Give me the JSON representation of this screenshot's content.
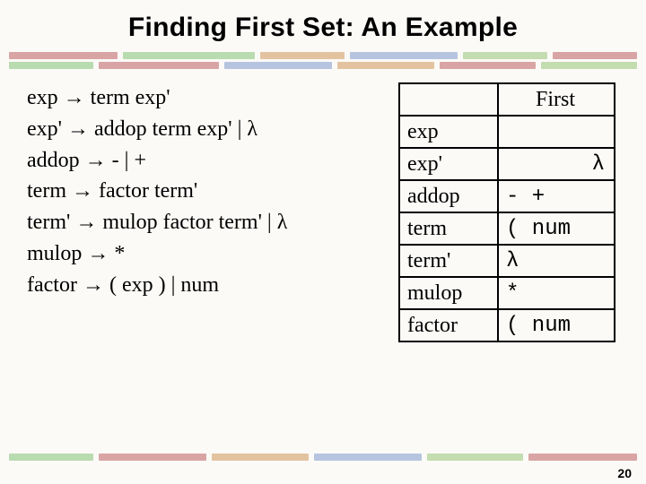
{
  "title": "Finding First Set: An Example",
  "grammar": {
    "lines": [
      {
        "lhs": "exp",
        "rhs": "term exp'"
      },
      {
        "lhs": "exp'",
        "rhs": "addop term exp' | λ"
      },
      {
        "lhs": "addop",
        "rhs": "- | +"
      },
      {
        "lhs": "term",
        "rhs": "factor term'"
      },
      {
        "lhs": "term'",
        "rhs": "mulop factor term' | λ"
      },
      {
        "lhs": "mulop",
        "rhs": "*"
      },
      {
        "lhs": "factor",
        "rhs": "( exp ) | num"
      }
    ],
    "arrow": "→"
  },
  "table": {
    "header": "First",
    "rows": [
      {
        "nt": "exp",
        "first": ""
      },
      {
        "nt": "exp'",
        "first": "       λ"
      },
      {
        "nt": "addop",
        "first": "- +"
      },
      {
        "nt": "term",
        "first": "( num"
      },
      {
        "nt": "term'",
        "first": "λ"
      },
      {
        "nt": "mulop",
        "first": "*"
      },
      {
        "nt": "factor",
        "first": "( num"
      }
    ]
  },
  "pagenum": "20"
}
